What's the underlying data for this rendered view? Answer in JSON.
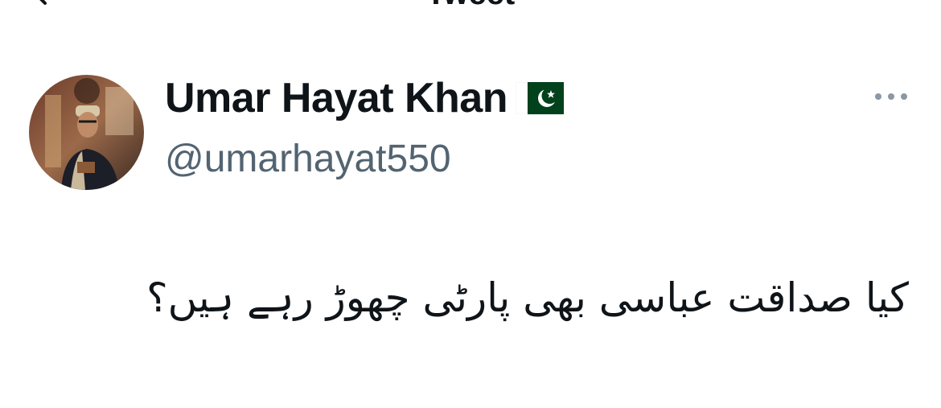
{
  "header": {
    "title": "Tweet",
    "back_icon": "chevron-left-icon"
  },
  "author": {
    "display_name": "Umar Hayat Khan",
    "flag_emoji": "🇵🇰",
    "flag_icon": "pakistan-flag-icon",
    "handle": "@umarhayat550",
    "avatar_icon": "profile-photo"
  },
  "actions": {
    "more_icon": "more-horizontal-icon"
  },
  "tweet": {
    "text": "کیا صداقت عباسی بھی پارٹی چھوڑ رہے ہیں؟"
  },
  "colors": {
    "primary_text": "#0f1419",
    "secondary_text": "#536471",
    "icon_gray": "#8b98a5",
    "flag_green": "#01411c",
    "background": "#ffffff"
  }
}
